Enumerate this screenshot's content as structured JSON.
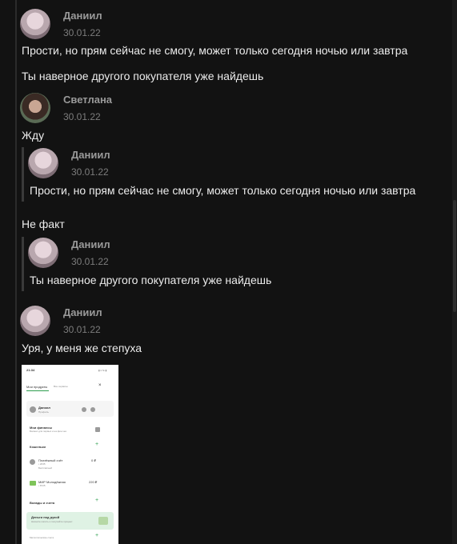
{
  "messages": [
    {
      "author": "Даниил",
      "date": "30.01.22",
      "text": "Прости, но прям сейчас не смогу, может только сегодня ночью или завтра",
      "text2": "Ты наверное другого покупателя уже найдешь"
    },
    {
      "author": "Светлана",
      "date": "30.01.22",
      "text": "Жду",
      "quote": {
        "author": "Даниил",
        "date": "30.01.22",
        "text": "Прости, но прям сейчас не смогу, может только сегодня ночью или завтра"
      }
    },
    {
      "text": "Не факт",
      "quote": {
        "author": "Даниил",
        "date": "30.01.22",
        "text": "Ты наверное другого покупателя уже найдешь"
      }
    },
    {
      "author": "Даниил",
      "date": "30.01.22",
      "text": "Уря, у меня же степуха"
    }
  ],
  "attachment": {
    "time": "21:34",
    "status": "▮ LTE ▮",
    "tab1": "Мои продукты",
    "tab2": "Все сервисы",
    "close": "×",
    "profile_name": "Даниил",
    "profile_sub": "Профиль",
    "finance": "Мои финансы",
    "finance_sub": "Баланс для первых и на фин.чек",
    "wallets": "Кошельки",
    "wallet1": "Платёжный счёт",
    "wallet1_sub": "• 2035",
    "wallet1_sub2": "Бесплатный",
    "wallet1_val": "0 ₽",
    "wallet2": "МИР Молодёжная",
    "wallet2_sub": "• 8725",
    "wallet2_val": "220 ₽",
    "deposits": "Вклады и счета",
    "banner_title": "Деньги под рукой",
    "banner_sub": "Начните копить и получайте процент",
    "bottom": "Металлические счета"
  }
}
